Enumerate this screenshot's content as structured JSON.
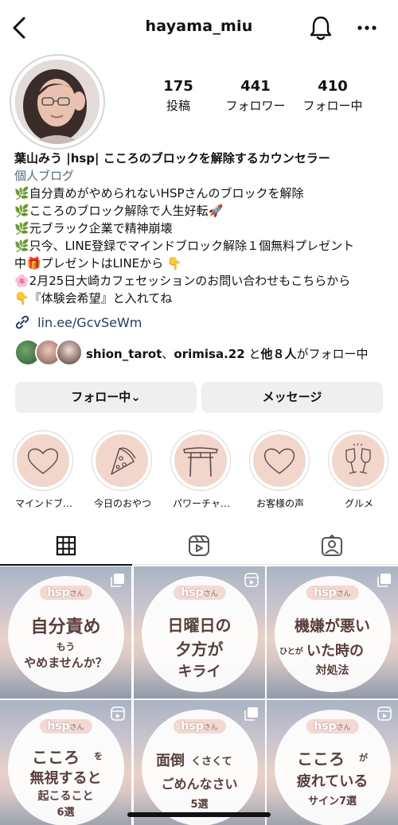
{
  "header": {
    "username": "hayama_miu",
    "icons": [
      "back-chevron-icon",
      "bell-icon",
      "more-dots-icon"
    ]
  },
  "profile": {
    "stats": [
      {
        "num": "175",
        "label": "投稿"
      },
      {
        "num": "441",
        "label": "フォロワー"
      },
      {
        "num": "410",
        "label": "フォロー中"
      }
    ],
    "bio": {
      "name": "葉山みう |hsp| こころのブロックを解除するカウンセラー",
      "category": "個人ブログ",
      "lines": [
        "🌿自分責めがやめられないHSPさんのブロックを解除",
        "🌿こころのブロック解除で人生好転🚀",
        "🌿元ブラック企業で精神崩壊",
        "🌿只今、LINE登録でマインドブロック解除１個無料プレゼント",
        "中🎁プレゼントはLINEから 👇",
        "🌸2月25日大崎カフェセッションのお問い合わせもこちらから",
        "👇『体験会希望』と入れてね"
      ],
      "link": "lin.ee/GcvSeWm"
    },
    "mutual": {
      "user1": "shion_tarot",
      "sep": "、",
      "user2": "orimisa.22",
      "rest1": "と",
      "rest2": "他８人",
      "rest3": "がフォロー中"
    },
    "buttons": {
      "follow": "フォロー中⌄",
      "message": "メッセージ"
    }
  },
  "highlights": [
    {
      "label": "マインドブ…",
      "icon": "heart-icon"
    },
    {
      "label": "今日のおやつ",
      "icon": "pizza-icon"
    },
    {
      "label": "パワーチャ…",
      "icon": "torii-gate-icon"
    },
    {
      "label": "お客様の声",
      "icon": "heart-icon"
    },
    {
      "label": "グルメ",
      "icon": "wine-glasses-icon"
    }
  ],
  "tabs": [
    "grid-icon",
    "reels-icon",
    "tagged-icon"
  ],
  "posts": [
    {
      "tag": "hsp",
      "tag_suffix": "さん",
      "lines": [
        "自分責め",
        "もう",
        "やめませんか？"
      ],
      "icon": "multi-image-icon"
    },
    {
      "tag": "hsp",
      "tag_suffix": "さん",
      "lines": [
        "日曜日の",
        "夕方が",
        "キライ"
      ],
      "icon": "reel-icon"
    },
    {
      "tag": "hsp",
      "tag_suffix": "さん",
      "lines": [
        "機嫌が悪い",
        "ひとが",
        "いた時の",
        "対処法"
      ],
      "icon": "multi-image-icon"
    },
    {
      "tag": "hsp",
      "tag_suffix": "さん",
      "lines": [
        "こころ",
        "を",
        "無視すると",
        "起こること",
        "6選"
      ],
      "icon": "reel-icon"
    },
    {
      "tag": "hsp",
      "tag_suffix": "さん",
      "lines": [
        "面倒",
        "くさくて",
        "ごめんなさい",
        "5選"
      ],
      "icon": "multi-image-icon"
    },
    {
      "tag": "hsp",
      "tag_suffix": "さん",
      "lines": [
        "こころ",
        "が",
        "疲れている",
        "サイン7選"
      ],
      "icon": "reel-icon"
    }
  ]
}
